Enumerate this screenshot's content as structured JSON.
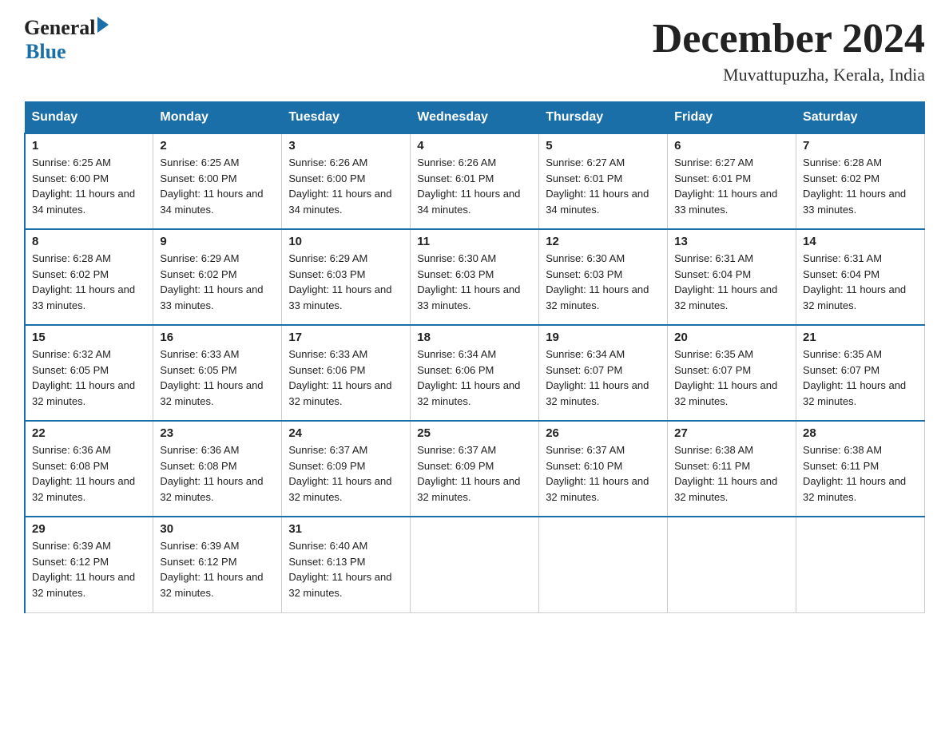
{
  "logo": {
    "general": "General",
    "blue": "Blue"
  },
  "title": "December 2024",
  "location": "Muvattupuzha, Kerala, India",
  "days_of_week": [
    "Sunday",
    "Monday",
    "Tuesday",
    "Wednesday",
    "Thursday",
    "Friday",
    "Saturday"
  ],
  "weeks": [
    [
      {
        "day": "1",
        "sunrise": "6:25 AM",
        "sunset": "6:00 PM",
        "daylight": "11 hours and 34 minutes."
      },
      {
        "day": "2",
        "sunrise": "6:25 AM",
        "sunset": "6:00 PM",
        "daylight": "11 hours and 34 minutes."
      },
      {
        "day": "3",
        "sunrise": "6:26 AM",
        "sunset": "6:00 PM",
        "daylight": "11 hours and 34 minutes."
      },
      {
        "day": "4",
        "sunrise": "6:26 AM",
        "sunset": "6:01 PM",
        "daylight": "11 hours and 34 minutes."
      },
      {
        "day": "5",
        "sunrise": "6:27 AM",
        "sunset": "6:01 PM",
        "daylight": "11 hours and 34 minutes."
      },
      {
        "day": "6",
        "sunrise": "6:27 AM",
        "sunset": "6:01 PM",
        "daylight": "11 hours and 33 minutes."
      },
      {
        "day": "7",
        "sunrise": "6:28 AM",
        "sunset": "6:02 PM",
        "daylight": "11 hours and 33 minutes."
      }
    ],
    [
      {
        "day": "8",
        "sunrise": "6:28 AM",
        "sunset": "6:02 PM",
        "daylight": "11 hours and 33 minutes."
      },
      {
        "day": "9",
        "sunrise": "6:29 AM",
        "sunset": "6:02 PM",
        "daylight": "11 hours and 33 minutes."
      },
      {
        "day": "10",
        "sunrise": "6:29 AM",
        "sunset": "6:03 PM",
        "daylight": "11 hours and 33 minutes."
      },
      {
        "day": "11",
        "sunrise": "6:30 AM",
        "sunset": "6:03 PM",
        "daylight": "11 hours and 33 minutes."
      },
      {
        "day": "12",
        "sunrise": "6:30 AM",
        "sunset": "6:03 PM",
        "daylight": "11 hours and 32 minutes."
      },
      {
        "day": "13",
        "sunrise": "6:31 AM",
        "sunset": "6:04 PM",
        "daylight": "11 hours and 32 minutes."
      },
      {
        "day": "14",
        "sunrise": "6:31 AM",
        "sunset": "6:04 PM",
        "daylight": "11 hours and 32 minutes."
      }
    ],
    [
      {
        "day": "15",
        "sunrise": "6:32 AM",
        "sunset": "6:05 PM",
        "daylight": "11 hours and 32 minutes."
      },
      {
        "day": "16",
        "sunrise": "6:33 AM",
        "sunset": "6:05 PM",
        "daylight": "11 hours and 32 minutes."
      },
      {
        "day": "17",
        "sunrise": "6:33 AM",
        "sunset": "6:06 PM",
        "daylight": "11 hours and 32 minutes."
      },
      {
        "day": "18",
        "sunrise": "6:34 AM",
        "sunset": "6:06 PM",
        "daylight": "11 hours and 32 minutes."
      },
      {
        "day": "19",
        "sunrise": "6:34 AM",
        "sunset": "6:07 PM",
        "daylight": "11 hours and 32 minutes."
      },
      {
        "day": "20",
        "sunrise": "6:35 AM",
        "sunset": "6:07 PM",
        "daylight": "11 hours and 32 minutes."
      },
      {
        "day": "21",
        "sunrise": "6:35 AM",
        "sunset": "6:07 PM",
        "daylight": "11 hours and 32 minutes."
      }
    ],
    [
      {
        "day": "22",
        "sunrise": "6:36 AM",
        "sunset": "6:08 PM",
        "daylight": "11 hours and 32 minutes."
      },
      {
        "day": "23",
        "sunrise": "6:36 AM",
        "sunset": "6:08 PM",
        "daylight": "11 hours and 32 minutes."
      },
      {
        "day": "24",
        "sunrise": "6:37 AM",
        "sunset": "6:09 PM",
        "daylight": "11 hours and 32 minutes."
      },
      {
        "day": "25",
        "sunrise": "6:37 AM",
        "sunset": "6:09 PM",
        "daylight": "11 hours and 32 minutes."
      },
      {
        "day": "26",
        "sunrise": "6:37 AM",
        "sunset": "6:10 PM",
        "daylight": "11 hours and 32 minutes."
      },
      {
        "day": "27",
        "sunrise": "6:38 AM",
        "sunset": "6:11 PM",
        "daylight": "11 hours and 32 minutes."
      },
      {
        "day": "28",
        "sunrise": "6:38 AM",
        "sunset": "6:11 PM",
        "daylight": "11 hours and 32 minutes."
      }
    ],
    [
      {
        "day": "29",
        "sunrise": "6:39 AM",
        "sunset": "6:12 PM",
        "daylight": "11 hours and 32 minutes."
      },
      {
        "day": "30",
        "sunrise": "6:39 AM",
        "sunset": "6:12 PM",
        "daylight": "11 hours and 32 minutes."
      },
      {
        "day": "31",
        "sunrise": "6:40 AM",
        "sunset": "6:13 PM",
        "daylight": "11 hours and 32 minutes."
      },
      null,
      null,
      null,
      null
    ]
  ]
}
